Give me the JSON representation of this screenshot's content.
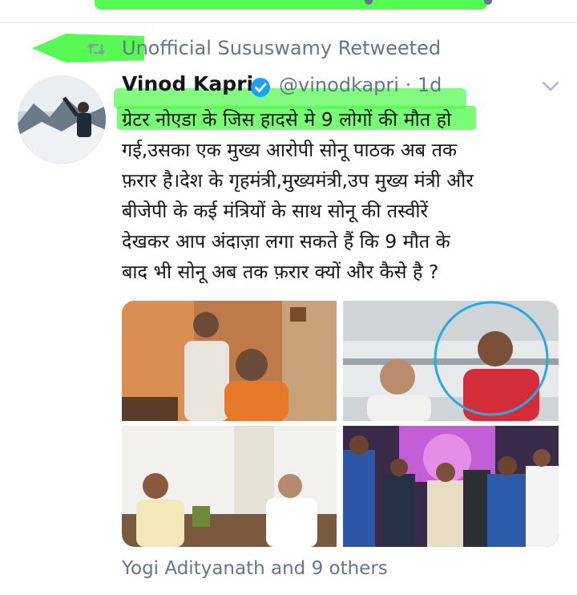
{
  "retweet": {
    "text": "Unofficial Sususwamy Retweeted"
  },
  "tweet": {
    "author_name": "Vinod Kapri",
    "handle_time": "@vinodkapri · 1d",
    "text_lines": [
      "ग्रेटर नोएडा के जिस हादसे मे 9 लोगों की मौत हो",
      "गई,उसका एक मुख्य आरोपी सोनू पाठक अब तक",
      "फ़रार है।देश के गृहमंत्री,मुख्यमंत्री,उप मुख्य मंत्री और",
      "बीजेपी के कई मंत्रियों के साथ सोनू की तस्वीरें",
      "देखकर आप अंदाज़ा लगा सकते हैं कि 9 मौत के",
      "बाद भी सोनू अब तक फ़रार क्यों और कैसे है ?"
    ]
  },
  "footer": {
    "liked_by": "Yogi Adityanath and 9 others"
  },
  "icons": {
    "retweet": "retweet-icon",
    "verified": "verified-badge-icon",
    "menu": "chevron-down-icon"
  },
  "colors": {
    "highlight": "#4dfa4a",
    "muted": "#657786",
    "verified": "#1da1f2",
    "text": "#14171a"
  }
}
